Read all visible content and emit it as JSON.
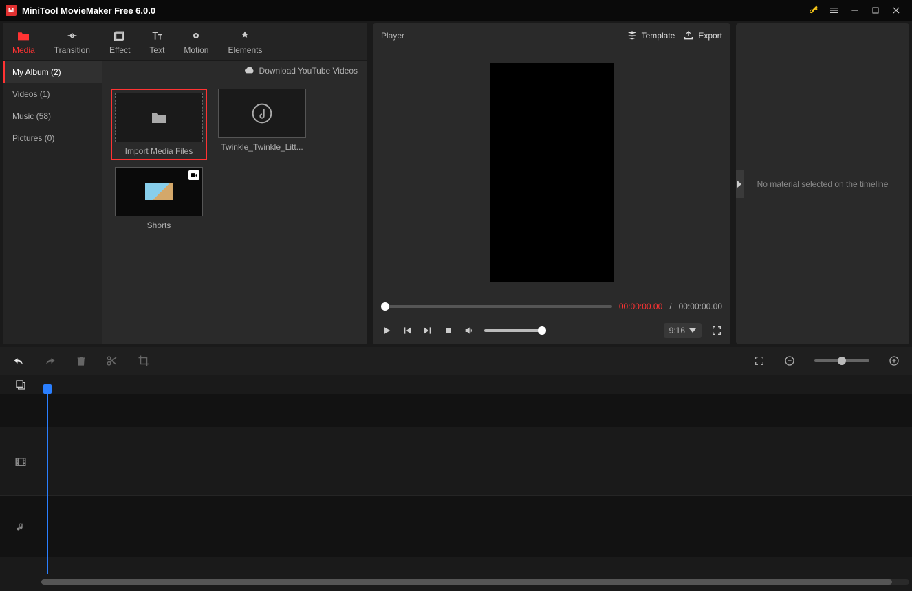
{
  "titlebar": {
    "title": "MiniTool MovieMaker Free 6.0.0"
  },
  "tabs": [
    {
      "label": "Media",
      "icon": "folder"
    },
    {
      "label": "Transition",
      "icon": "transition"
    },
    {
      "label": "Effect",
      "icon": "effect"
    },
    {
      "label": "Text",
      "icon": "text"
    },
    {
      "label": "Motion",
      "icon": "motion"
    },
    {
      "label": "Elements",
      "icon": "elements"
    }
  ],
  "sidebar": {
    "items": [
      {
        "label": "My Album (2)"
      },
      {
        "label": "Videos (1)"
      },
      {
        "label": "Music (58)"
      },
      {
        "label": "Pictures (0)"
      }
    ]
  },
  "media_header": {
    "download_link": "Download YouTube Videos"
  },
  "media_tiles": {
    "import": "Import Media Files",
    "audio": "Twinkle_Twinkle_Litt...",
    "video": "Shorts"
  },
  "player": {
    "title": "Player",
    "template_btn": "Template",
    "export_btn": "Export",
    "time_current": "00:00:00.00",
    "time_sep": "/",
    "time_total": "00:00:00.00",
    "aspect": "9:16"
  },
  "props": {
    "empty": "No material selected on the timeline"
  }
}
